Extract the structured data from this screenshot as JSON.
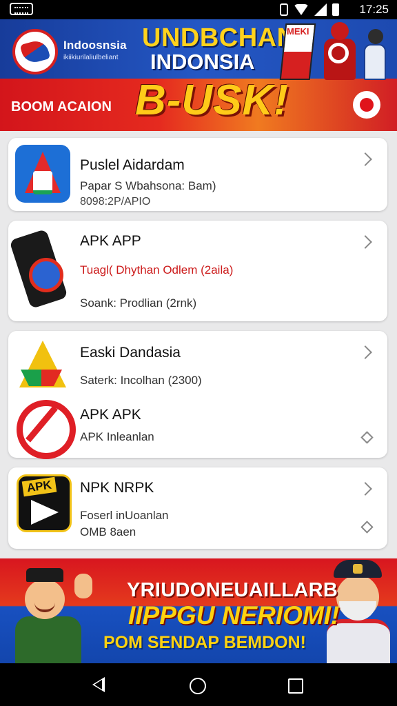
{
  "status_bar": {
    "time": "17:25"
  },
  "top_banner": {
    "org_name": "Indoosnsia",
    "org_sub": "ikiikiurilaliulbeliant",
    "title_line1": "UNDBCHAN",
    "title_line2": "INDONSIA",
    "big_text": "B-USK!",
    "action_label": "BOOM ACAION",
    "flag_text": "MEKI"
  },
  "apps": [
    {
      "title": "Puslel Aidardam",
      "sub1": "Papar S Wbahsona: Bam)",
      "sub2": "8098:2P/APIO"
    },
    {
      "title": "APK APP",
      "sub1": "Tuagl( Dhythan Odlem (2aila)",
      "sub2": "Soank: Prodlian (2rnk)"
    },
    {
      "title": "Easki Dandasia",
      "sub1": "Saterk: Incolhan (2300)"
    },
    {
      "title": "APK APK",
      "sub1": "APK Inleanlan"
    },
    {
      "title": "NPK NRPK",
      "sub1": "Foserl inUoanlan",
      "sub2": "OMB 8aen",
      "icon_label": "APK"
    }
  ],
  "bottom_banner": {
    "line1": "YRIUDONEUAILLARB",
    "line2": "IIPPGU NERIOMI!",
    "line3": "POM SENDAP BEMDON!"
  },
  "colors": {
    "brand_red": "#d3151b",
    "brand_blue": "#1d4ab0",
    "accent_yellow": "#ffcb19",
    "subtitle_red": "#cc1a1a"
  }
}
